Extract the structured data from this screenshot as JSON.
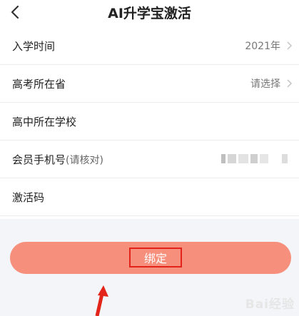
{
  "header": {
    "title": "AI升学宝激活"
  },
  "form": {
    "rows": [
      {
        "label": "入学时间",
        "value": "2021年"
      },
      {
        "label": "高考所在省",
        "value": "请选择"
      },
      {
        "label": "高中所在学校"
      },
      {
        "label": "会员手机号",
        "hint": "(请核对)"
      },
      {
        "label": "激活码"
      }
    ]
  },
  "actions": {
    "bind_label": "绑定"
  },
  "watermark": {
    "text": "Bai经验"
  },
  "colors": {
    "button": "#f6907c",
    "highlight_box": "#e2241b",
    "arrow": "#e2241b",
    "lower_bg": "#f3f5f8"
  }
}
